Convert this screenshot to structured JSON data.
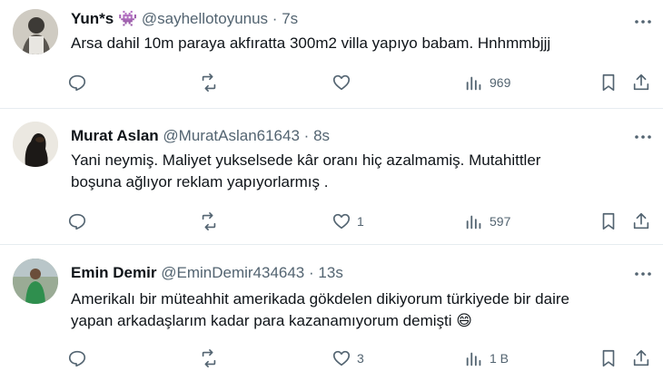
{
  "tweets": [
    {
      "name": "Yun*s",
      "name_emoji": "👾",
      "handle": "@sayhellotoyunus",
      "separator": "·",
      "time": "7s",
      "text_lines": [
        "Arsa dahil 10m paraya akfıratta 300m2 villa yapıyo babam. Hnhmmbjjj"
      ],
      "replies": "",
      "retweets": "",
      "likes": "",
      "views": "969"
    },
    {
      "name": "Murat Aslan",
      "handle": "@MuratAslan61643",
      "separator": "·",
      "time": "8s",
      "text_lines": [
        "Yani neymiş. Maliyet yukselsede kâr oranı hiç azalmamiş. Mutahittler",
        "boşuna ağlıyor reklam yapıyorlarmış ."
      ],
      "replies": "",
      "retweets": "",
      "likes": "1",
      "views": "597"
    },
    {
      "name": "Emin Demir",
      "handle": "@EminDemir434643",
      "separator": "·",
      "time": "13s",
      "text_lines": [
        "Amerikalı bir müteahhit amerikada gökdelen dikiyorum türkiyede bir daire",
        "yapan arkadaşlarım kadar para kazanamıyorum demişti 😄"
      ],
      "replies": "",
      "retweets": "",
      "likes": "3",
      "views": "1 B"
    }
  ],
  "colors": {
    "text": "#0f1419",
    "secondary": "#536471",
    "divider": "#e6ecf0"
  },
  "icons": [
    "reply-icon",
    "retweet-icon",
    "like-icon",
    "views-icon",
    "bookmark-icon",
    "share-icon",
    "more-icon"
  ]
}
